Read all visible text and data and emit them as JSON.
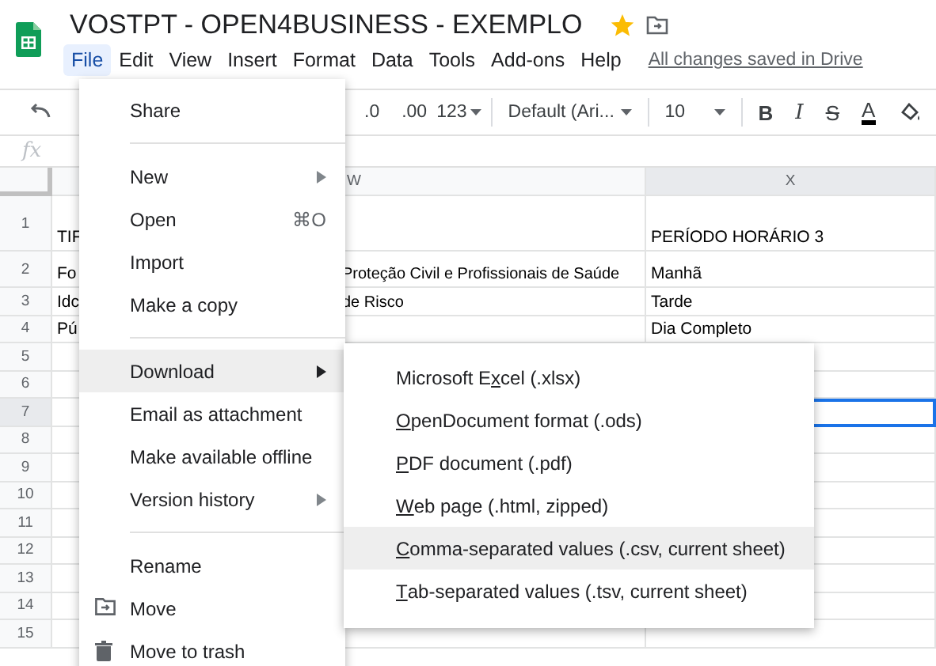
{
  "document": {
    "title": "VOSTPT - OPEN4BUSINESS - EXEMPLO",
    "starred": true
  },
  "menubar": {
    "items": [
      {
        "label": "File",
        "selected": true
      },
      {
        "label": "Edit",
        "selected": false
      },
      {
        "label": "View",
        "selected": false
      },
      {
        "label": "Insert",
        "selected": false
      },
      {
        "label": "Format",
        "selected": false
      },
      {
        "label": "Data",
        "selected": false
      },
      {
        "label": "Tools",
        "selected": false
      },
      {
        "label": "Add-ons",
        "selected": false
      },
      {
        "label": "Help",
        "selected": false
      }
    ],
    "save_status": "All changes saved in Drive"
  },
  "toolbar": {
    "decimal_decrease": ".0",
    "decimal_increase": ".00",
    "number_format": "123",
    "font": "Default (Ari...",
    "font_size": "10",
    "bold": "B",
    "italic": "I",
    "strikethrough": "S",
    "text_color": "A"
  },
  "formula_bar": {
    "symbol": "fx"
  },
  "sheet": {
    "columns": [
      {
        "label": "W",
        "selected": false
      },
      {
        "label": "X",
        "selected": true
      }
    ],
    "rows": [
      {
        "number": "1",
        "col_v": "TIF",
        "col_x": "PERÍODO HORÁRIO 3",
        "selected": false
      },
      {
        "number": "2",
        "col_v": "Fo",
        "col_w": "Proteção Civil e Profissionais de Saúde",
        "col_x": "Manhã",
        "selected": false
      },
      {
        "number": "3",
        "col_v": "Idc",
        "col_w": "de Risco",
        "col_x": "Tarde",
        "selected": false
      },
      {
        "number": "4",
        "col_v": "Pú",
        "col_x": "Dia Completo",
        "selected": false
      },
      {
        "number": "5",
        "selected": false
      },
      {
        "number": "6",
        "selected": false
      },
      {
        "number": "7",
        "selected": true
      },
      {
        "number": "8",
        "selected": false
      },
      {
        "number": "9",
        "selected": false
      },
      {
        "number": "10",
        "selected": false
      },
      {
        "number": "11",
        "selected": false
      },
      {
        "number": "12",
        "selected": false
      },
      {
        "number": "13",
        "selected": false
      },
      {
        "number": "14",
        "selected": false
      },
      {
        "number": "15",
        "selected": false
      }
    ]
  },
  "file_menu": {
    "items": [
      {
        "kind": "item",
        "label": "Share",
        "selected": false
      },
      {
        "kind": "divider"
      },
      {
        "kind": "item",
        "label": "New",
        "submenu": true,
        "selected": false
      },
      {
        "kind": "item",
        "label": "Open",
        "shortcut": "⌘O",
        "selected": false
      },
      {
        "kind": "item",
        "label": "Import",
        "selected": false
      },
      {
        "kind": "item",
        "label": "Make a copy",
        "selected": false
      },
      {
        "kind": "divider"
      },
      {
        "kind": "item",
        "label": "Download",
        "submenu": true,
        "selected": true
      },
      {
        "kind": "item",
        "label": "Email as attachment",
        "selected": false
      },
      {
        "kind": "item",
        "label": "Make available offline",
        "selected": false
      },
      {
        "kind": "item",
        "label": "Version history",
        "submenu": true,
        "selected": false
      },
      {
        "kind": "divider"
      },
      {
        "kind": "item",
        "label": "Rename",
        "selected": false
      },
      {
        "kind": "move",
        "label": "Move",
        "selected": false
      },
      {
        "kind": "trash",
        "label": "Move to trash",
        "selected": false
      }
    ]
  },
  "download_menu": {
    "items": [
      {
        "before": "Microsoft E",
        "key": "x",
        "after": "cel (.xlsx)",
        "selected": false
      },
      {
        "key": "O",
        "after": "penDocument format (.ods)",
        "selected": false
      },
      {
        "key": "P",
        "after": "DF document (.pdf)",
        "selected": false
      },
      {
        "key": "W",
        "after": "eb page (.html, zipped)",
        "selected": false
      },
      {
        "key": "C",
        "after": "omma-separated values (.csv, current sheet)",
        "selected": true
      },
      {
        "key": "T",
        "after": "ab-separated values (.tsv, current sheet)",
        "selected": false
      }
    ]
  }
}
